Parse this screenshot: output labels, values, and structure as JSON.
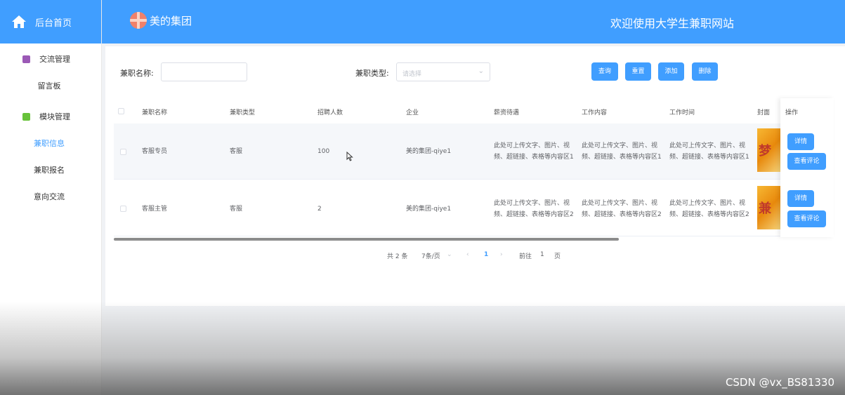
{
  "sidebar": {
    "home_label": "后台首页",
    "groups": [
      {
        "label": "交流管理",
        "color": "#9b59b6",
        "items": [
          "留言板"
        ]
      },
      {
        "label": "模块管理",
        "color": "#67c23a",
        "items": [
          "兼职信息",
          "兼职报名",
          "意向交流"
        ]
      }
    ],
    "active_item": "兼职信息"
  },
  "header": {
    "brand": "美的集团",
    "welcome": "欢迎使用大学生兼职网站"
  },
  "search": {
    "name_label": "兼职名称:",
    "name_value": "",
    "type_label": "兼职类型:",
    "type_placeholder": "请选择",
    "buttons": {
      "query": "查询",
      "reset": "重置",
      "add": "添加",
      "delete": "删除"
    }
  },
  "table": {
    "headers": [
      "兼职名称",
      "兼职类型",
      "招聘人数",
      "企业",
      "薪资待遇",
      "工作内容",
      "工作时间",
      "封面",
      "操作"
    ],
    "rows": [
      {
        "name": "客服专员",
        "type": "客服",
        "count": "100",
        "company": "美的集团-qiye1",
        "salary_1": "此处可上传文字、图片、视",
        "salary_2": "频、超链接、表格等内容区1",
        "content_1": "此处可上传文字、图片、视",
        "content_2": "频、超链接、表格等内容区1",
        "time_1": "此处可上传文字、图片、视",
        "time_2": "频、超链接、表格等内容区1",
        "cover_text": "梦"
      },
      {
        "name": "客服主管",
        "type": "客服",
        "count": "2",
        "company": "美的集团-qiye1",
        "salary_1": "此处可上传文字、图片、视",
        "salary_2": "频、超链接、表格等内容区2",
        "content_1": "此处可上传文字、图片、视",
        "content_2": "频、超链接、表格等内容区2",
        "time_1": "此处可上传文字、图片、视",
        "time_2": "频、超链接、表格等内容区2",
        "cover_text": "兼"
      }
    ],
    "op_detail": "详情",
    "op_comments": "查看评论"
  },
  "pagination": {
    "total": "共 2 条",
    "page_size": "7条/页",
    "current": "1",
    "goto_prefix": "前往",
    "goto_value": "1",
    "goto_suffix": "页"
  },
  "watermark": "CSDN @vx_BS81330",
  "colors": {
    "primary": "#409eff"
  }
}
